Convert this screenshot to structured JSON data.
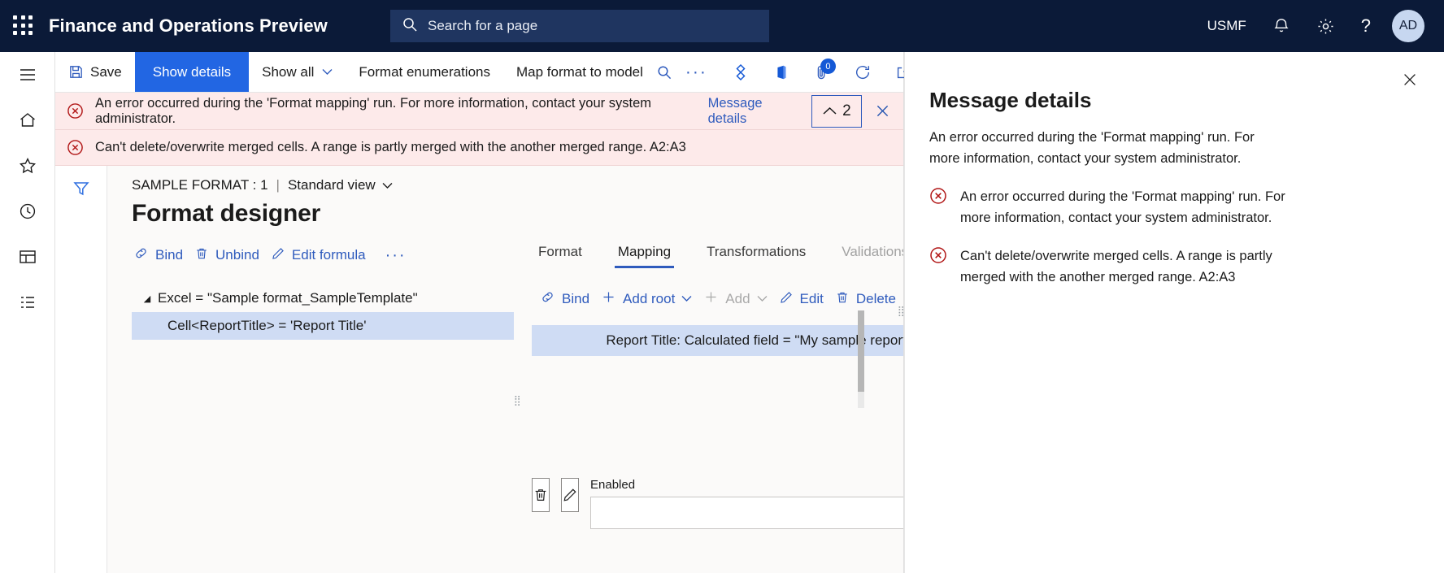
{
  "topnav": {
    "waffle_icon": "app-launcher-icon",
    "brand": "Finance and Operations Preview",
    "search": {
      "placeholder": "Search for a page",
      "icon": "search-icon"
    },
    "company": "USMF",
    "notifications_icon": "bell-icon",
    "settings_icon": "gear-icon",
    "help_label": "?",
    "avatar_initials": "AD"
  },
  "rail": {
    "menu_icon": "hamburger-icon",
    "home_icon": "home-icon",
    "favorites_icon": "star-icon",
    "recent_icon": "clock-icon",
    "workspaces_icon": "workspaces-icon",
    "modules_icon": "modules-icon"
  },
  "commandbar": {
    "save_label": "Save",
    "save_icon": "save-icon",
    "show_details_label": "Show details",
    "show_all_label": "Show all",
    "format_enumerations_label": "Format enumerations",
    "map_format_to_model_label": "Map format to model",
    "search_icon": "search-icon",
    "overflow_label": "···",
    "power_bi_icon": "power-platform-icon",
    "office_icon": "office-icon",
    "attachments_icon": "attachment-icon",
    "attachments_count": "0",
    "refresh_icon": "refresh-icon",
    "popout_icon": "open-in-new-window-icon",
    "close_icon": "close-icon"
  },
  "messages": {
    "bar1": {
      "icon": "error-icon",
      "text": "An error occurred during the 'Format mapping' run. For more information, contact your system administrator.",
      "details_link": "Message details",
      "collapse_chevron": "⌃",
      "count": "2",
      "close_icon": "close-icon"
    },
    "bar2": {
      "icon": "error-icon",
      "text": "Can't delete/overwrite merged cells. A range is partly merged with the another merged range. A2:A3"
    }
  },
  "page": {
    "filter_icon": "filter-icon",
    "breadcrumb_record": "SAMPLE FORMAT : 1",
    "breadcrumb_divider": "|",
    "view_selector": "Standard view",
    "view_chevron": "⌄",
    "title": "Format designer"
  },
  "format_tree": {
    "toolbar": [
      {
        "label": "Bind",
        "icon": "link-icon",
        "disabled": false
      },
      {
        "label": "Unbind",
        "icon": "trash-icon",
        "disabled": false
      },
      {
        "label": "Edit formula",
        "icon": "pencil-icon",
        "disabled": false
      }
    ],
    "overflow": "···",
    "nodes": [
      {
        "label": "Excel = \"Sample format_SampleTemplate\"",
        "expander": "◢",
        "selected": false
      },
      {
        "label": "Cell<ReportTitle> = 'Report Title'",
        "expander": "",
        "selected": true
      }
    ]
  },
  "detail_panel": {
    "tabs": [
      {
        "label": "Format",
        "selected": false,
        "disabled": false
      },
      {
        "label": "Mapping",
        "selected": true,
        "disabled": false
      },
      {
        "label": "Transformations",
        "selected": false,
        "disabled": false
      },
      {
        "label": "Validations",
        "selected": false,
        "disabled": true
      }
    ],
    "toolbar": [
      {
        "label": "Bind",
        "icon": "link-icon",
        "disabled": false,
        "chevron": ""
      },
      {
        "label": "Add root",
        "icon": "plus-icon",
        "disabled": false,
        "chevron": "⌄"
      },
      {
        "label": "Add",
        "icon": "plus-icon",
        "disabled": true,
        "chevron": "⌄"
      },
      {
        "label": "Edit",
        "icon": "pencil-icon",
        "disabled": false,
        "chevron": ""
      },
      {
        "label": "Delete",
        "icon": "trash-icon",
        "disabled": false,
        "chevron": ""
      }
    ],
    "overflow": "···",
    "rows": [
      {
        "label": "Report Title: Calculated field = \"My sample report\": String",
        "selected": true
      }
    ]
  },
  "bottom": {
    "delete_icon": "trash-icon",
    "edit_icon": "pencil-icon",
    "enabled_label": "Enabled",
    "enabled_value": ""
  },
  "flyout": {
    "close_icon": "close-icon",
    "title": "Message details",
    "lead": "An error occurred during the 'Format mapping' run. For more information, contact your system administrator.",
    "items": [
      {
        "icon": "error-icon",
        "text": "An error occurred during the 'Format mapping' run. For more information, contact your system administrator."
      },
      {
        "icon": "error-icon",
        "text": "Can't delete/overwrite merged cells. A range is partly merged with the another merged range. A2:A3"
      }
    ]
  },
  "colors": {
    "nav_bg": "#0b1a38",
    "accent": "#2266e3",
    "link": "#2f5bbd",
    "error_bg": "#fdeaea",
    "error_red": "#b11616",
    "selection": "#cfdcf4"
  }
}
